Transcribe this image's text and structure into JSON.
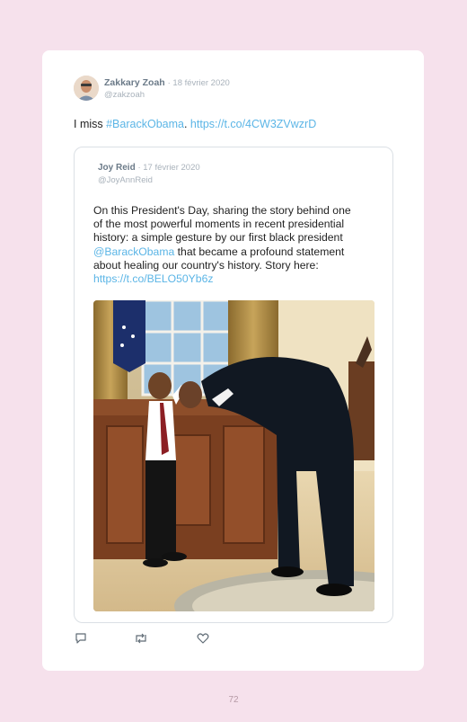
{
  "tweet": {
    "author_name": "Zakkary Zoah",
    "date": "· 18 février 2020",
    "handle": "@zakzoah",
    "text_prefix": "I miss ",
    "hashtag": "#BarackObama",
    "text_middle": ". ",
    "link": "https://t.co/4CW3ZVwzrD"
  },
  "quoted_tweet": {
    "author_name": "Joy Reid",
    "date": "· 17 février 2020",
    "handle": "@JoyAnnReid",
    "text_part1": "On this President's Day, sharing the story behind one of the most powerful moments in recent presidential history: a simple gesture by our first black president ",
    "mention": "@BarackObama",
    "text_part2": " that became a profound statement about healing our country's history. Story here: ",
    "link": "https://t.co/BELO50Yb6z"
  },
  "actions": {
    "reply_icon": "reply-icon",
    "retweet_icon": "retweet-icon",
    "like_icon": "heart-icon"
  },
  "page_number": "72",
  "colors": {
    "background": "#f6e1ec",
    "link": "#5bb5e6",
    "name": "#6b7a88",
    "muted": "#a9b2bb"
  }
}
